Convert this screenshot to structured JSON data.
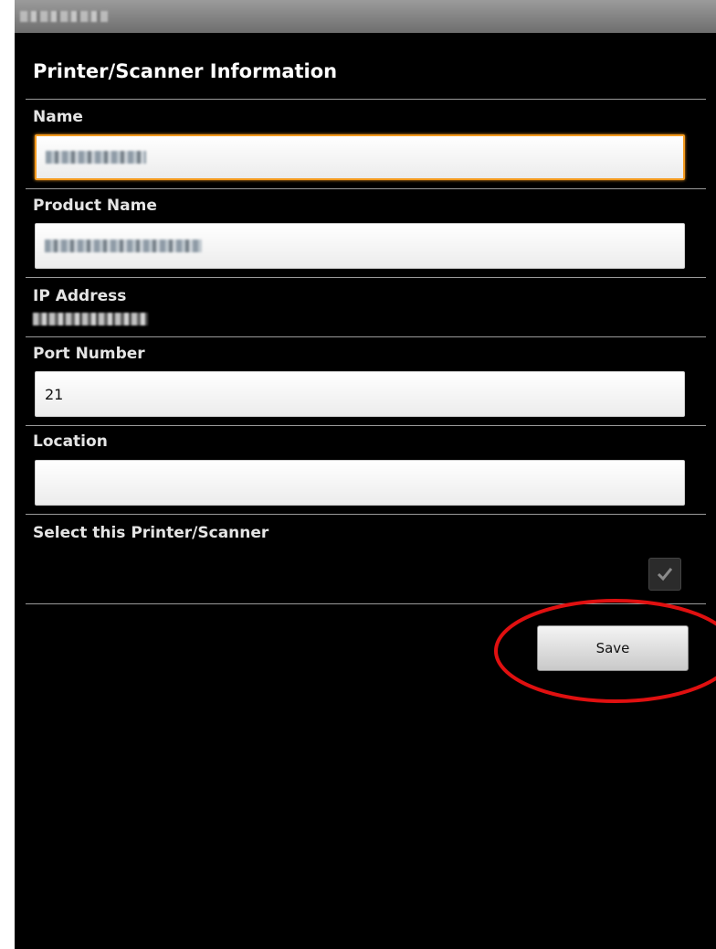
{
  "screen_title": "Printer/Scanner Information",
  "fields": {
    "name": {
      "label": "Name",
      "value": ""
    },
    "product_name": {
      "label": "Product Name",
      "value": ""
    },
    "ip_address": {
      "label": "IP Address",
      "value": ""
    },
    "port_number": {
      "label": "Port Number",
      "value": "21"
    },
    "location": {
      "label": "Location",
      "value": ""
    }
  },
  "select_printer": {
    "label": "Select this Printer/Scanner",
    "checked": true
  },
  "save_label": "Save",
  "colors": {
    "background": "#000000",
    "focus_border": "#f39a1f",
    "annotation": "#e01010"
  },
  "icons": {
    "checkbox": "checkmark-icon"
  }
}
